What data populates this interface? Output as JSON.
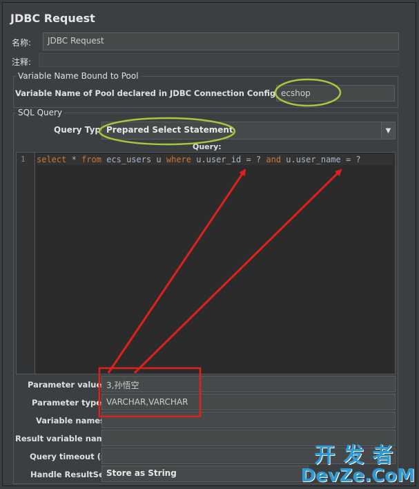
{
  "window": {
    "title": "JDBC Request"
  },
  "name_label": "名称:",
  "name_value": "JDBC Request",
  "comment_label": "注释:",
  "pool_group": {
    "title": "Variable Name Bound to Pool",
    "label": "Variable Name of Pool declared in JDBC Connection Configuration:",
    "value": "ecshop"
  },
  "sql_group": {
    "title": "SQL Query",
    "query_type_label": "Query Type:",
    "query_type_value": "Prepared Select Statement",
    "query_label": "Query:",
    "line_number": "1",
    "sql": {
      "kw_select": "select",
      "part1": " * ",
      "kw_from": "from",
      "part2": " ecs_users u ",
      "kw_where": "where",
      "part3": " u.user_id = ? ",
      "kw_and": "and",
      "part4": " u.user_name = ?"
    }
  },
  "params": {
    "parameter_values_label": "Parameter values:",
    "parameter_values": "3,孙悟空",
    "parameter_types_label": "Parameter types:",
    "parameter_types": "VARCHAR,VARCHAR",
    "variable_names_label": "Variable names:",
    "variable_names": "",
    "result_variable_label": "Result variable name:",
    "result_variable": "",
    "query_timeout_label": "Query timeout (s):",
    "query_timeout": "",
    "handle_resultset_label": "Handle ResultSet:",
    "handle_resultset": "Store as String"
  },
  "watermark": {
    "line1": "开发者",
    "line2": "DevZe.CoM"
  },
  "colors": {
    "annotation_green": "#a7c83c",
    "annotation_red": "#e0201a",
    "keyword": "#cc7832"
  }
}
